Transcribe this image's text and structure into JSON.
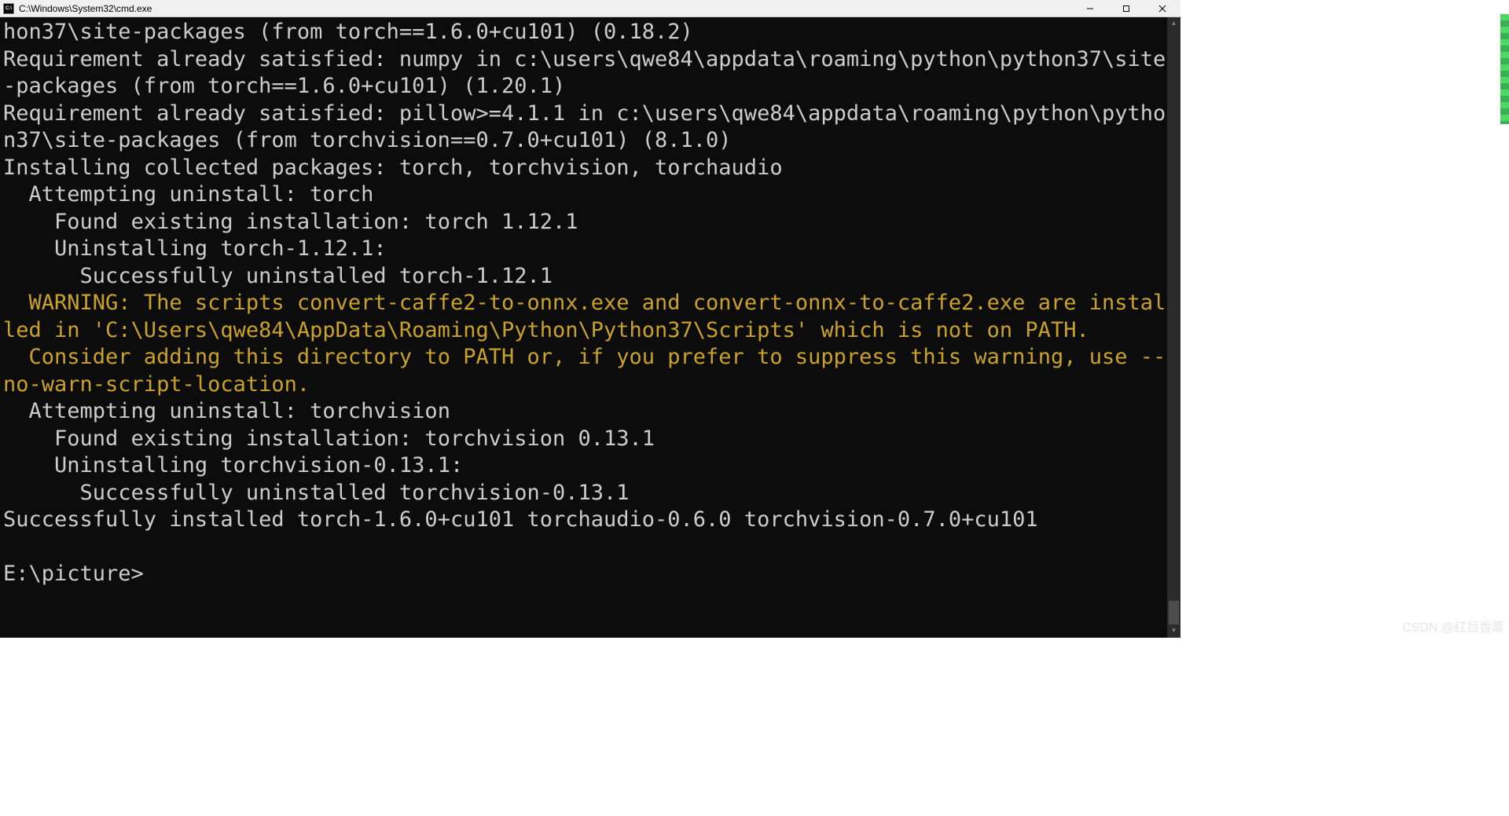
{
  "window": {
    "title": "C:\\Windows\\System32\\cmd.exe",
    "icon_label": "cmd-icon"
  },
  "terminal": {
    "lines": [
      {
        "text": "hon37\\site-packages (from torch==1.6.0+cu101) (0.18.2)",
        "class": ""
      },
      {
        "text": "Requirement already satisfied: numpy in c:\\users\\qwe84\\appdata\\roaming\\python\\python37\\site-packages (from torch==1.6.0+cu101) (1.20.1)",
        "class": ""
      },
      {
        "text": "Requirement already satisfied: pillow>=4.1.1 in c:\\users\\qwe84\\appdata\\roaming\\python\\python37\\site-packages (from torchvision==0.7.0+cu101) (8.1.0)",
        "class": ""
      },
      {
        "text": "Installing collected packages: torch, torchvision, torchaudio",
        "class": ""
      },
      {
        "text": "  Attempting uninstall: torch",
        "class": ""
      },
      {
        "text": "    Found existing installation: torch 1.12.1",
        "class": ""
      },
      {
        "text": "    Uninstalling torch-1.12.1:",
        "class": ""
      },
      {
        "text": "      Successfully uninstalled torch-1.12.1",
        "class": ""
      },
      {
        "text": "  WARNING: The scripts convert-caffe2-to-onnx.exe and convert-onnx-to-caffe2.exe are installed in 'C:\\Users\\qwe84\\AppData\\Roaming\\Python\\Python37\\Scripts' which is not on PATH.",
        "class": "warning"
      },
      {
        "text": "  Consider adding this directory to PATH or, if you prefer to suppress this warning, use --no-warn-script-location.",
        "class": "warning"
      },
      {
        "text": "  Attempting uninstall: torchvision",
        "class": ""
      },
      {
        "text": "    Found existing installation: torchvision 0.13.1",
        "class": ""
      },
      {
        "text": "    Uninstalling torchvision-0.13.1:",
        "class": ""
      },
      {
        "text": "      Successfully uninstalled torchvision-0.13.1",
        "class": ""
      },
      {
        "text": "Successfully installed torch-1.6.0+cu101 torchaudio-0.6.0 torchvision-0.7.0+cu101",
        "class": ""
      },
      {
        "text": "",
        "class": ""
      },
      {
        "text": "E:\\picture>",
        "class": ""
      }
    ]
  },
  "watermark": {
    "text": "CSDN @红目香薰"
  },
  "colors": {
    "terminal_bg": "#0c0c0c",
    "terminal_fg": "#cccccc",
    "warning_fg": "#c9a227"
  }
}
